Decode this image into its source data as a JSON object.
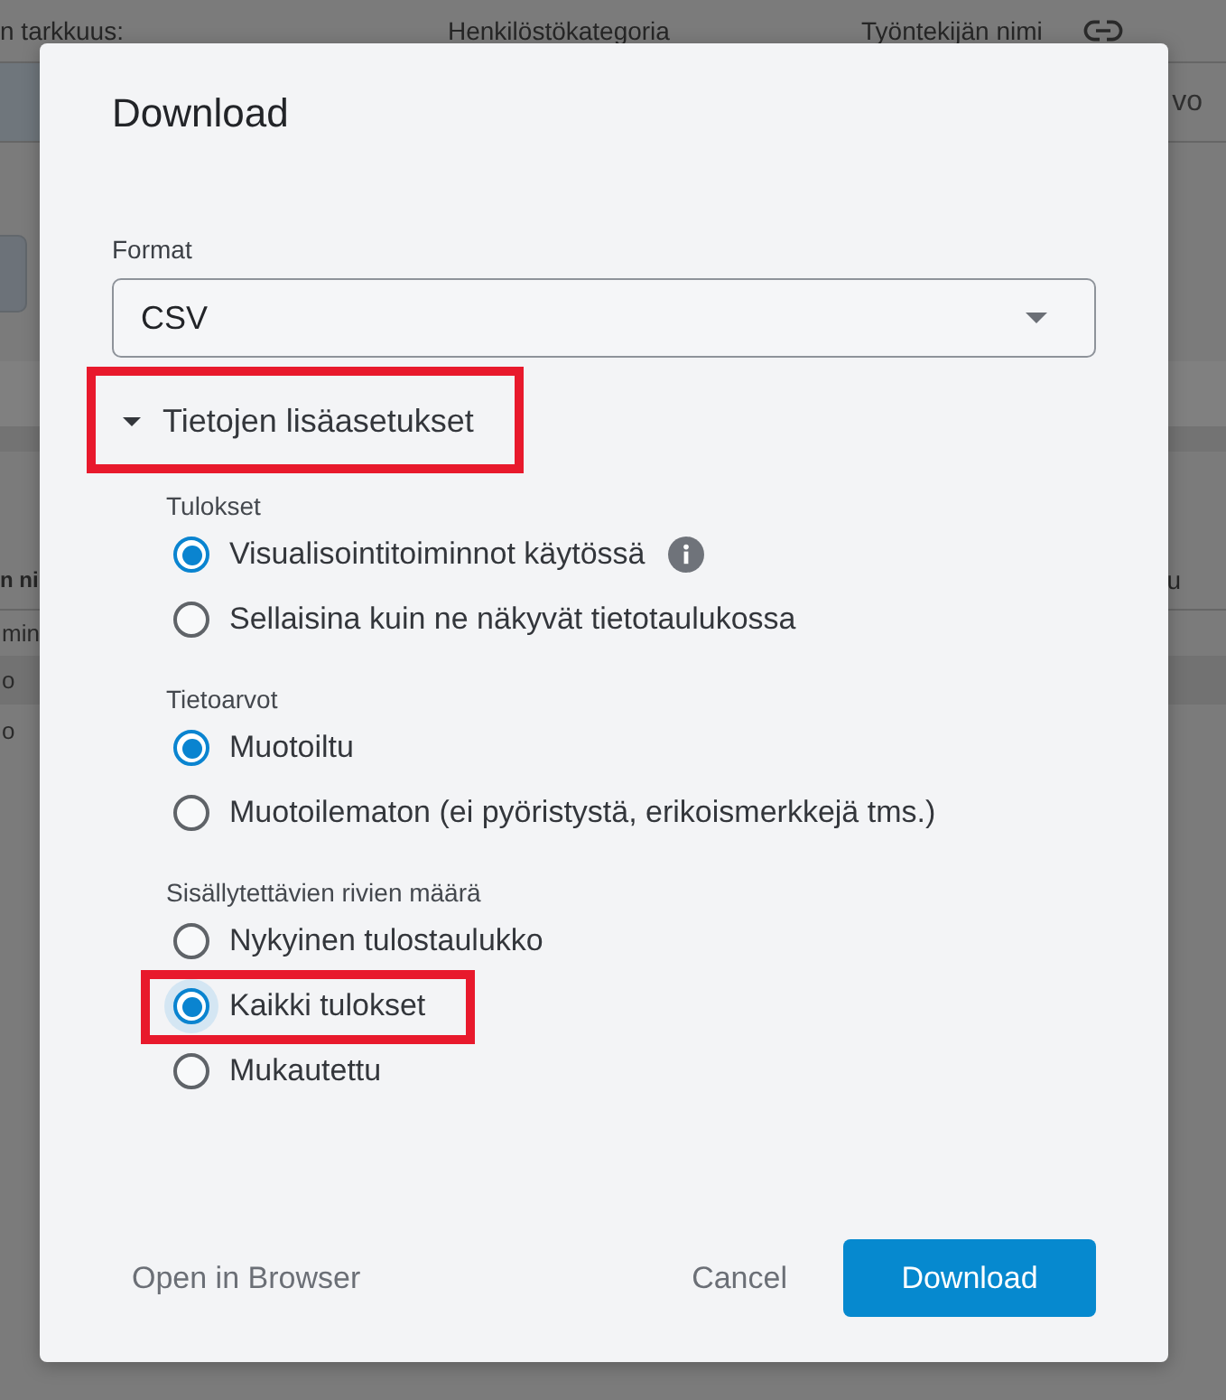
{
  "background_page": {
    "header_texts": [
      "n tarkkuus:",
      "Henkilöstökategoria",
      "Työntekijän nimi"
    ],
    "row_text_right": "vo",
    "column_header_left": "n ni",
    "column_header_right": "u",
    "cells_left": [
      "min",
      "o",
      "o"
    ]
  },
  "dialog": {
    "title": "Download",
    "format": {
      "label": "Format",
      "value": "CSV"
    },
    "advanced": {
      "label": "Tietojen lisäasetukset",
      "expanded": true,
      "highlighted": true
    },
    "groups": [
      {
        "label": "Tulokset",
        "options": [
          {
            "label": "Visualisointitoiminnot käytössä",
            "selected": true,
            "focused": false,
            "highlighted": false,
            "info": true
          },
          {
            "label": "Sellaisina kuin ne näkyvät tietotaulukossa",
            "selected": false,
            "focused": false,
            "highlighted": false,
            "info": false
          }
        ]
      },
      {
        "label": "Tietoarvot",
        "options": [
          {
            "label": "Muotoiltu",
            "selected": true,
            "focused": false,
            "highlighted": false,
            "info": false
          },
          {
            "label": "Muotoilematon (ei pyöristystä, erikoismerkkejä tms.)",
            "selected": false,
            "focused": false,
            "highlighted": false,
            "info": false
          }
        ]
      },
      {
        "label": "Sisällytettävien rivien määrä",
        "options": [
          {
            "label": "Nykyinen tulostaulukko",
            "selected": false,
            "focused": false,
            "highlighted": false,
            "info": false
          },
          {
            "label": "Kaikki tulokset",
            "selected": true,
            "focused": true,
            "highlighted": true,
            "info": false
          },
          {
            "label": "Mukautettu",
            "selected": false,
            "focused": false,
            "highlighted": false,
            "info": false
          }
        ]
      }
    ],
    "footer": {
      "open_in_browser": "Open in Browser",
      "cancel": "Cancel",
      "download": "Download"
    }
  }
}
